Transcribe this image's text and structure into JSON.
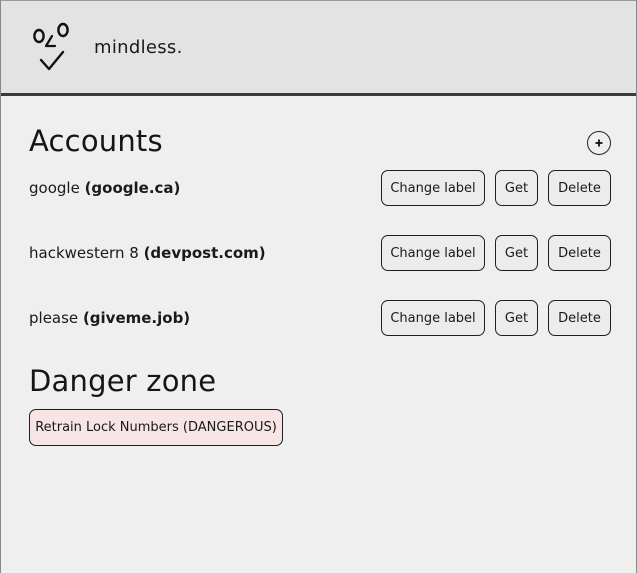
{
  "header": {
    "logo_icon": "face-logo-icon",
    "brand_name": "mindless."
  },
  "accounts": {
    "title": "Accounts",
    "add_icon": "plus-circle-icon",
    "items": [
      {
        "label": "google",
        "domain": "(google.ca)",
        "change_label_text": "Change label",
        "get_text": "Get",
        "delete_text": "Delete"
      },
      {
        "label": "hackwestern 8",
        "domain": "(devpost.com)",
        "change_label_text": "Change label",
        "get_text": "Get",
        "delete_text": "Delete"
      },
      {
        "label": "please",
        "domain": "(giveme.job)",
        "change_label_text": "Change label",
        "get_text": "Get",
        "delete_text": "Delete"
      }
    ]
  },
  "danger": {
    "title": "Danger zone",
    "retrain_label": "Retrain Lock Numbers (DANGEROUS)",
    "retrain_color": "#f7e4e4"
  }
}
